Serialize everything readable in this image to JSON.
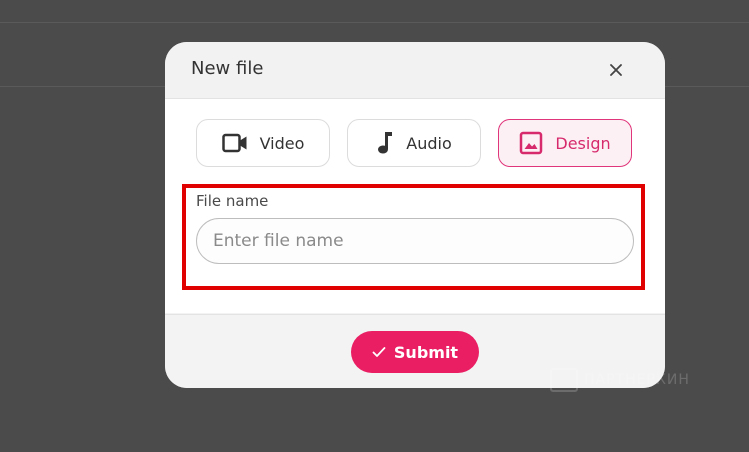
{
  "modal": {
    "title": "New file",
    "close_icon": "close-icon",
    "types": [
      {
        "label": "Video",
        "icon": "video-camera-icon",
        "active": false
      },
      {
        "label": "Audio",
        "icon": "music-note-icon",
        "active": false
      },
      {
        "label": "Design",
        "icon": "image-icon",
        "active": true
      }
    ],
    "file_name": {
      "label": "File name",
      "placeholder": "Enter file name",
      "value": ""
    },
    "submit": {
      "label": "Submit",
      "icon": "check-icon"
    }
  },
  "watermark": {
    "text": "ПАРТНЕРКИН"
  },
  "colors": {
    "accent": "#e91e63",
    "active_border": "#e0357a",
    "highlight": "#e00000",
    "backdrop": "#4b4b4b"
  }
}
